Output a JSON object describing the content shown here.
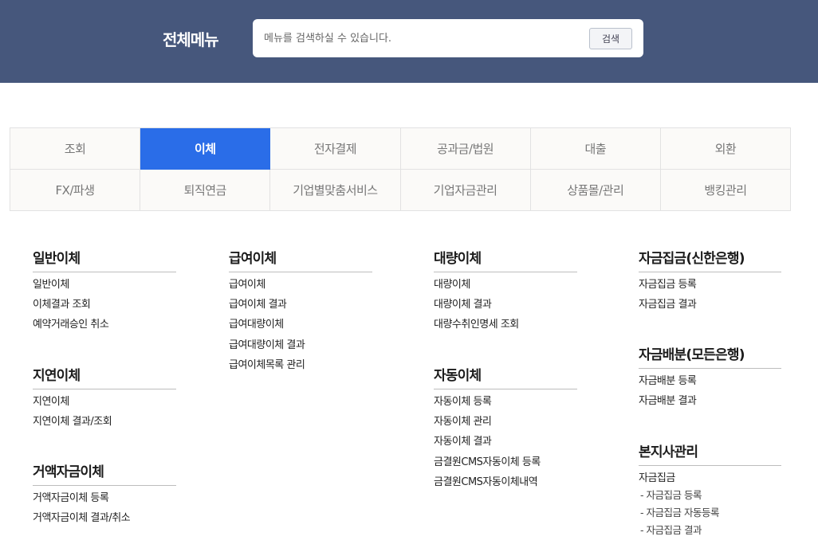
{
  "header": {
    "title": "전체메뉴",
    "search_placeholder": "메뉴를 검색하실 수 있습니다.",
    "search_button": "검색"
  },
  "tabs": [
    {
      "label": "조회",
      "active": false
    },
    {
      "label": "이체",
      "active": true
    },
    {
      "label": "전자결제",
      "active": false
    },
    {
      "label": "공과금/법원",
      "active": false
    },
    {
      "label": "대출",
      "active": false
    },
    {
      "label": "외환",
      "active": false
    },
    {
      "label": "FX/파생",
      "active": false
    },
    {
      "label": "퇴직연금",
      "active": false
    },
    {
      "label": "기업별맞춤서비스",
      "active": false
    },
    {
      "label": "기업자금관리",
      "active": false
    },
    {
      "label": "상품몰/관리",
      "active": false
    },
    {
      "label": "뱅킹관리",
      "active": false
    }
  ],
  "columns": [
    {
      "groups": [
        {
          "title": "일반이체",
          "items": [
            "일반이체",
            "이체결과 조회",
            "예약거래승인 취소"
          ]
        },
        {
          "title": "지연이체",
          "items": [
            "지연이체",
            "지연이체 결과/조회"
          ]
        },
        {
          "title": "거액자금이체",
          "items": [
            "거액자금이체 등록",
            "거액자금이체 결과/취소"
          ]
        }
      ]
    },
    {
      "groups": [
        {
          "title": "급여이체",
          "items": [
            "급여이체",
            "급여이체 결과",
            "급여대량이체",
            "급여대량이체 결과",
            "급여이체목록 관리"
          ]
        }
      ]
    },
    {
      "groups": [
        {
          "title": "대량이체",
          "items": [
            "대량이체",
            "대량이체 결과",
            "대량수취인명세 조회"
          ]
        },
        {
          "title": "자동이체",
          "items": [
            "자동이체 등록",
            "자동이체 관리",
            "자동이체 결과",
            "금결원CMS자동이체 등록",
            "금결원CMS자동이체내역"
          ]
        }
      ]
    },
    {
      "groups": [
        {
          "title": "자금집금(신한은행)",
          "items": [
            "자금집금 등록",
            "자금집금 결과"
          ]
        },
        {
          "title": "자금배분(모든은행)",
          "items": [
            "자금배분 등록",
            "자금배분 결과"
          ]
        },
        {
          "title": "본지사관리",
          "items": [
            "자금집금"
          ],
          "sub_items": [
            "- 자금집금 등록",
            "- 자금집금 자동등록",
            "- 자금집금 결과"
          ]
        }
      ]
    }
  ],
  "colors": {
    "header_bg": "#46577c",
    "active_tab": "#2a6de8"
  }
}
